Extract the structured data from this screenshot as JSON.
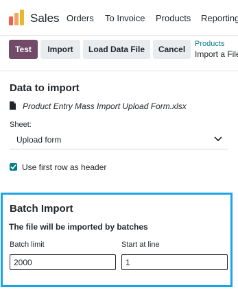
{
  "app": {
    "name": "Sales",
    "nav": [
      "Orders",
      "To Invoice",
      "Products",
      "Reporting"
    ]
  },
  "toolbar": {
    "test_label": "Test",
    "import_label": "Import",
    "load_label": "Load Data File",
    "cancel_label": "Cancel"
  },
  "breadcrumb": {
    "parent": "Products",
    "current": "Import a File"
  },
  "data_to_import": {
    "title": "Data to import",
    "file_name": "Product Entry Mass Import Upload Form.xlsx",
    "sheet_label": "Sheet:",
    "sheet_value": "Upload form",
    "header_checkbox_label": "Use first row as header",
    "header_checked": true
  },
  "batch_import": {
    "title": "Batch Import",
    "note": "The file will be imported by batches",
    "batch_limit_label": "Batch limit",
    "batch_limit_value": "2000",
    "start_line_label": "Start at line",
    "start_line_value": "1"
  },
  "colors": {
    "brand": "#714b67",
    "accent_teal": "#017e84",
    "highlight": "#1aa3e8"
  },
  "icons": {
    "logo": "odoo-sales-logo",
    "file": "file-icon",
    "chevron": "chevron-down-icon",
    "check": "check-icon"
  }
}
